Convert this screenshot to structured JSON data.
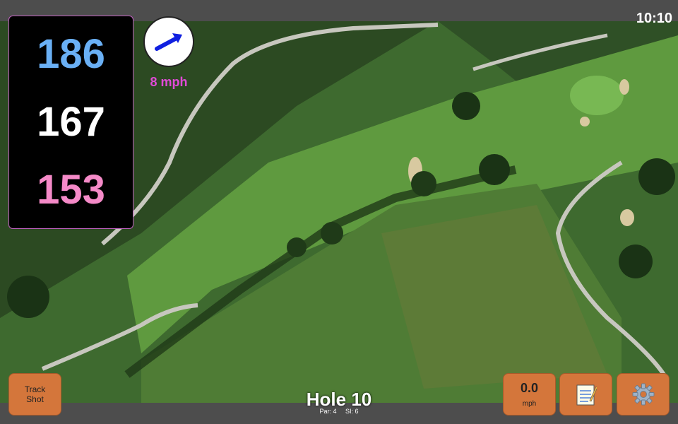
{
  "status": {
    "clock": "10:10"
  },
  "distances": {
    "front": "186",
    "middle": "167",
    "back": "153"
  },
  "wind": {
    "speed_label": "8 mph",
    "direction_icon": "arrow-icon"
  },
  "hole": {
    "title": "Hole 10",
    "par_label": "Par: 4",
    "si_label": "SI: 6"
  },
  "buttons": {
    "track_shot_line1": "Track",
    "track_shot_line2": "Shot",
    "speed_value": "0.0",
    "speed_unit": "mph",
    "notes_icon": "notepad-icon",
    "settings_icon": "gear-icon"
  },
  "colors": {
    "front": "#6ab0f5",
    "middle": "#ffffff",
    "back": "#f58ac8",
    "wind_text": "#e14ad8",
    "button": "#d4763b"
  }
}
